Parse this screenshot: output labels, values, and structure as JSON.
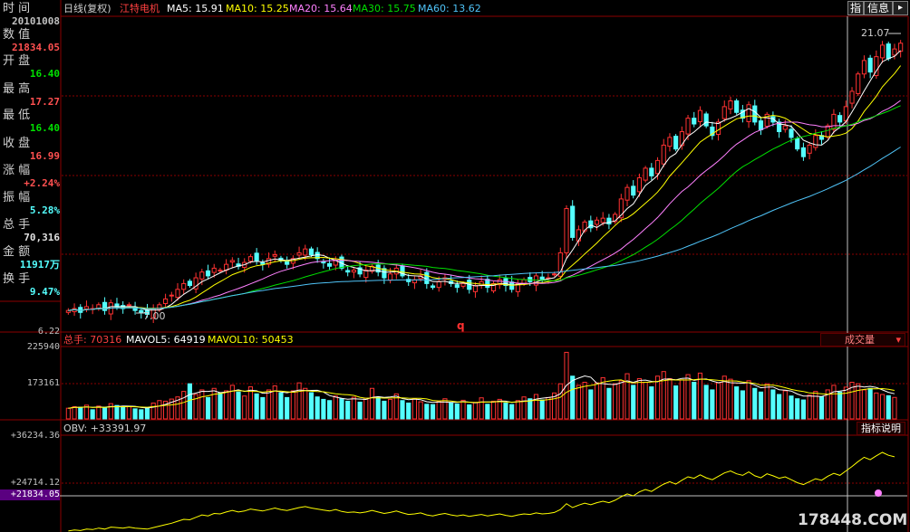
{
  "colors": {
    "up": "#ff3232",
    "down": "#54ffff",
    "grid": "#8b0000",
    "ma5": "#ffffff",
    "ma10": "#ffff00",
    "ma20": "#ff80ff",
    "ma30": "#00e000",
    "ma60": "#4fc3f7",
    "obv": "#ffff00"
  },
  "info_panel": {
    "time_label": "时      间",
    "time_value": "20101008",
    "value_label": "数      值",
    "value_value": "21834.05",
    "open_label": "开      盘",
    "open_value": "16.40",
    "high_label": "最      高",
    "high_value": "17.27",
    "low_label": "最      低",
    "low_value": "16.40",
    "close_label": "收      盘",
    "close_value": "16.99",
    "change_label": "涨      幅",
    "change_value": "+2.24%",
    "amplitude_label": "振      幅",
    "amplitude_value": "5.28%",
    "volume_label": "总      手",
    "volume_value": "70,316",
    "amount_label": "金      额",
    "amount_value": "11917万",
    "turnover_label": "换      手",
    "turnover_value": "9.47%"
  },
  "header": {
    "period": "日线(复权)",
    "stock_name": "江特电机",
    "ma5": "MA5: 15.91",
    "ma10": "MA10: 15.25",
    "ma20": "MA20: 15.64",
    "ma30": "MA30: 15.75",
    "ma60": "MA60: 13.62",
    "btn_indicator": "指",
    "btn_info": "信息"
  },
  "volume_header": {
    "total": "总手: 70316",
    "mavol5": "MAVOL5: 64919",
    "mavol10": "MAVOL10: 50453",
    "dropdown": "成交量"
  },
  "obv_header": {
    "label": "OBV: +33391.97",
    "button": "指标说明"
  },
  "axis": {
    "price_low": "6.22",
    "vol_high": "225940",
    "vol_mid": "173161",
    "obv_high": "+36234.36",
    "obv_mid": "+24714.12",
    "obv_cur": "+21834.05"
  },
  "annotations": {
    "high_price": "21.07",
    "low_price": "7.00",
    "marker": "q"
  },
  "watermark": "178448.COM",
  "chart_data": {
    "type": "candlestick",
    "price_range": [
      6.22,
      22.5
    ],
    "closes": [
      7.2,
      7.3,
      7.1,
      7.4,
      7.3,
      7.5,
      7.2,
      7.6,
      7.4,
      7.3,
      7.5,
      7.2,
      7.1,
      7.0,
      7.3,
      7.5,
      7.8,
      8.0,
      8.3,
      8.6,
      8.5,
      8.9,
      9.2,
      9.0,
      9.4,
      9.3,
      9.6,
      9.8,
      9.5,
      9.7,
      10.0,
      9.8,
      9.6,
      9.9,
      10.1,
      9.8,
      9.6,
      9.9,
      10.2,
      10.4,
      10.1,
      9.9,
      9.7,
      9.5,
      9.8,
      9.4,
      9.2,
      9.3,
      9.1,
      9.3,
      9.5,
      9.2,
      8.9,
      9.1,
      9.4,
      9.0,
      8.7,
      8.8,
      9.0,
      8.6,
      8.4,
      8.7,
      8.9,
      8.6,
      8.4,
      8.6,
      8.3,
      8.5,
      8.7,
      8.4,
      8.6,
      8.8,
      8.5,
      8.3,
      8.6,
      8.8,
      8.7,
      9.0,
      8.8,
      8.9,
      9.1,
      10.2,
      12.5,
      11.0,
      11.4,
      11.8,
      11.5,
      11.9,
      12.0,
      11.7,
      12.2,
      13.0,
      13.6,
      13.2,
      14.1,
      14.6,
      14.2,
      15.0,
      15.8,
      16.2,
      15.6,
      16.5,
      17.2,
      16.9,
      17.6,
      16.8,
      16.3,
      17.0,
      17.8,
      18.1,
      17.5,
      17.2,
      17.9,
      17.0,
      16.6,
      17.4,
      17.0,
      16.5,
      16.8,
      16.2,
      15.6,
      15.2,
      15.8,
      16.3,
      16.1,
      16.8,
      17.4,
      17.0,
      17.8,
      18.6,
      19.5,
      20.2,
      19.6,
      20.4,
      21.0,
      20.3,
      20.8,
      21.1
    ],
    "volume_range": [
      0,
      240000
    ],
    "volumes": [
      35000,
      40000,
      38000,
      45000,
      30000,
      42000,
      36000,
      50000,
      44000,
      38000,
      41000,
      33000,
      30000,
      37000,
      52000,
      60000,
      58000,
      65000,
      72000,
      90000,
      115000,
      80000,
      95000,
      70000,
      100000,
      85000,
      92000,
      110000,
      88000,
      75000,
      105000,
      82000,
      70000,
      95000,
      108000,
      85000,
      70000,
      92000,
      118000,
      100000,
      86000,
      72000,
      64000,
      60000,
      75000,
      66000,
      58000,
      71000,
      55000,
      68000,
      100000,
      70000,
      58000,
      64000,
      82000,
      60000,
      52000,
      66000,
      56000,
      48000,
      47000,
      58000,
      66000,
      52000,
      49000,
      61000,
      46000,
      54000,
      69000,
      48000,
      58000,
      64000,
      52000,
      47000,
      60000,
      72000,
      66000,
      80000,
      62000,
      70000,
      85000,
      115000,
      218000,
      140000,
      110000,
      120000,
      95000,
      118000,
      135000,
      100000,
      115000,
      125000,
      148000,
      110000,
      132000,
      120000,
      105000,
      140000,
      155000,
      132000,
      108000,
      128000,
      145000,
      120000,
      150000,
      110000,
      95000,
      118000,
      140000,
      130000,
      105000,
      92000,
      125000,
      100000,
      88000,
      115000,
      95000,
      80000,
      92000,
      75000,
      66000,
      62000,
      78000,
      90000,
      72000,
      95000,
      110000,
      88000,
      104000,
      120000,
      115000,
      95000,
      100000,
      85000,
      80000,
      76000,
      70316
    ],
    "obv_range": [
      18000,
      38000
    ],
    "obv_values": [
      18200,
      18400,
      18300,
      18600,
      18500,
      18800,
      18600,
      19000,
      18900,
      18800,
      19000,
      18800,
      18700,
      18600,
      18900,
      19200,
      19500,
      19800,
      20200,
      20600,
      20500,
      21000,
      21500,
      21300,
      21800,
      21700,
      22100,
      22400,
      22100,
      22300,
      22700,
      22500,
      22300,
      22600,
      22900,
      22600,
      22400,
      22700,
      23000,
      23200,
      22900,
      22700,
      22500,
      22300,
      22600,
      22200,
      22000,
      22100,
      21900,
      22100,
      22400,
      22100,
      21800,
      22000,
      22300,
      21900,
      21600,
      21700,
      21900,
      21500,
      21300,
      21600,
      21800,
      21500,
      21300,
      21500,
      21200,
      21400,
      21600,
      21300,
      21500,
      21700,
      21400,
      21200,
      21500,
      21700,
      21600,
      21900,
      21700,
      21800,
      22000,
      22600,
      23800,
      23000,
      23500,
      23900,
      23600,
      24000,
      24300,
      24000,
      24500,
      25200,
      25800,
      25400,
      26200,
      26700,
      26300,
      27100,
      27800,
      28300,
      27800,
      28600,
      29300,
      29000,
      29700,
      29100,
      28700,
      29400,
      30100,
      30500,
      29900,
      29600,
      30300,
      29500,
      29100,
      29900,
      29500,
      29000,
      29300,
      28700,
      28100,
      27700,
      28300,
      28900,
      28600,
      29400,
      30000,
      29600,
      30500,
      31400,
      32400,
      33300,
      32800,
      33600,
      34300,
      33700,
      33392
    ]
  }
}
